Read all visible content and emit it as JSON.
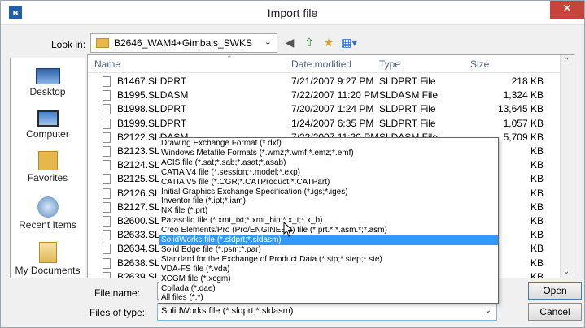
{
  "window": {
    "title": "Import file",
    "close_glyph": "✕",
    "app_icon_glyph": "в"
  },
  "toolbar": {
    "look_in_label": "Look in:",
    "look_in_value": "B2646_WAM4+Gimbals_SWKS",
    "icons": [
      "back-icon",
      "up-folder-icon",
      "new-folder-icon",
      "view-menu-icon"
    ]
  },
  "places": [
    {
      "label": "Desktop",
      "icon": "desktop-icon"
    },
    {
      "label": "Computer",
      "icon": "computer-icon"
    },
    {
      "label": "Favorites",
      "icon": "favorites-icon"
    },
    {
      "label": "Recent Items",
      "icon": "recent-items-icon"
    },
    {
      "label": "My Documents",
      "icon": "my-documents-icon"
    }
  ],
  "columns": {
    "name": "Name",
    "date": "Date modified",
    "type": "Type",
    "size": "Size"
  },
  "files": [
    {
      "name": "B1467.SLDPRT",
      "date": "7/21/2007 9:27 PM",
      "type": "SLDPRT File",
      "size": "218 KB"
    },
    {
      "name": "B1995.SLDASM",
      "date": "7/22/2007 11:20 PM",
      "type": "SLDASM File",
      "size": "1,324 KB"
    },
    {
      "name": "B1998.SLDPRT",
      "date": "7/20/2007 1:24 PM",
      "type": "SLDPRT File",
      "size": "13,645 KB"
    },
    {
      "name": "B1999.SLDPRT",
      "date": "1/24/2007 6:35 PM",
      "type": "SLDPRT File",
      "size": "1,057 KB"
    },
    {
      "name": "B2122.SLDASM",
      "date": "7/22/2007 11:20 PM",
      "type": "SLDASM File",
      "size": "5,709 KB"
    },
    {
      "name": "B2123.SLD",
      "date": "",
      "type": "",
      "size": "KB"
    },
    {
      "name": "B2124.SLD",
      "date": "",
      "type": "",
      "size": "KB"
    },
    {
      "name": "B2125.SLD",
      "date": "",
      "type": "",
      "size": "KB"
    },
    {
      "name": "B2126.SLD",
      "date": "",
      "type": "",
      "size": "KB"
    },
    {
      "name": "B2127.SLD",
      "date": "",
      "type": "",
      "size": "KB"
    },
    {
      "name": "B2600.SLD",
      "date": "",
      "type": "",
      "size": "KB"
    },
    {
      "name": "B2633.SLD",
      "date": "",
      "type": "",
      "size": "KB"
    },
    {
      "name": "B2634.SLD",
      "date": "",
      "type": "",
      "size": "KB"
    },
    {
      "name": "B2638.SLD",
      "date": "",
      "type": "",
      "size": "KB"
    },
    {
      "name": "B2639.SLD",
      "date": "",
      "type": "",
      "size": "KB"
    }
  ],
  "file_name": {
    "label": "File name:",
    "value": ""
  },
  "file_type": {
    "label": "Files of type:",
    "value": "SolidWorks file (*.sldprt;*.sldasm)",
    "options": [
      "Drawing Exchange Format (*.dxf)",
      "Windows Metafile Formats (*.wmz;*.wmf;*.emz;*.emf)",
      "ACIS file (*.sat;*.sab;*.asat;*.asab)",
      "CATIA V4 file (*.session;*.model;*.exp)",
      "CATIA V5 file (*.CGR;*.CATProduct;*.CATPart)",
      "Initial Graphics Exchange Specification (*.igs;*.iges)",
      "Inventor file (*.ipt;*.iam)",
      "NX file (*.prt)",
      "Parasolid file (*.xmt_txt;*.xmt_bin;*.x_t;*.x_b)",
      "Creo Elements/Pro (Pro/ENGINEER) file (*.prt.*;*.asm.*;*.asm)",
      "SolidWorks file (*.sldprt;*.sldasm)",
      "Solid Edge file (*.psm;*.par)",
      "Standard for the Exchange of Product Data (*.stp;*.step;*.ste)",
      "VDA-FS file (*.vda)",
      "XCGM file (*.xcgm)",
      "Collada (*.dae)",
      "All files (*.*)"
    ],
    "selected_index": 10
  },
  "buttons": {
    "open": "Open",
    "cancel": "Cancel"
  },
  "colors": {
    "selection": "#3399ff",
    "close_button": "#c6443b"
  }
}
